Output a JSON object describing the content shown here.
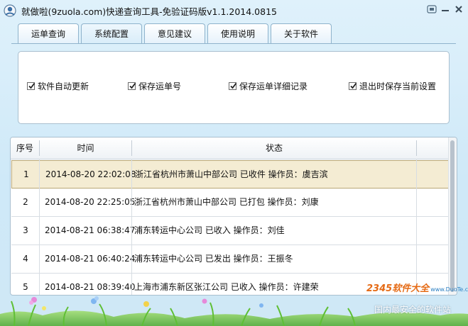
{
  "window": {
    "title": "就做啦(9zuola.com)快递查询工具-免验证码版v1.1.2014.0815"
  },
  "tabs": [
    {
      "label": "运单查询",
      "active": false
    },
    {
      "label": "系统配置",
      "active": true
    },
    {
      "label": "意见建议",
      "active": false
    },
    {
      "label": "使用说明",
      "active": false
    },
    {
      "label": "关于软件",
      "active": false
    }
  ],
  "settings": {
    "options": [
      {
        "label": "软件自动更新",
        "checked": true
      },
      {
        "label": "保存运单号",
        "checked": true
      },
      {
        "label": "保存运单详细记录",
        "checked": true
      },
      {
        "label": "退出时保存当前设置",
        "checked": true
      }
    ]
  },
  "table": {
    "columns": [
      "序号",
      "时间",
      "状态"
    ],
    "rows": [
      {
        "no": "1",
        "time": "2014-08-20 22:02:08",
        "status": "浙江省杭州市萧山中部公司 已收件 操作员：虞吉滨",
        "selected": true
      },
      {
        "no": "2",
        "time": "2014-08-20 22:25:05",
        "status": "浙江省杭州市萧山中部公司 已打包 操作员：刘康",
        "selected": false
      },
      {
        "no": "3",
        "time": "2014-08-21 06:38:47",
        "status": "浦东转运中心公司 已收入  操作员：刘佳",
        "selected": false
      },
      {
        "no": "4",
        "time": "2014-08-21 06:40:24",
        "status": "浦东转运中心公司 已发出 操作员：王振冬",
        "selected": false
      },
      {
        "no": "5",
        "time": "2014-08-21 08:39:40",
        "status": "上海市浦东新区张江公司 已收入  操作员：许建荣",
        "selected": false
      }
    ]
  },
  "branding": {
    "logo_text": "2345软件大全",
    "logo_sub": "www.DuoTe.com",
    "caption": "国内最安全的软件站"
  },
  "colors": {
    "selected_row_bg": "#f4ecd3",
    "logo_orange": "#e56b16"
  }
}
